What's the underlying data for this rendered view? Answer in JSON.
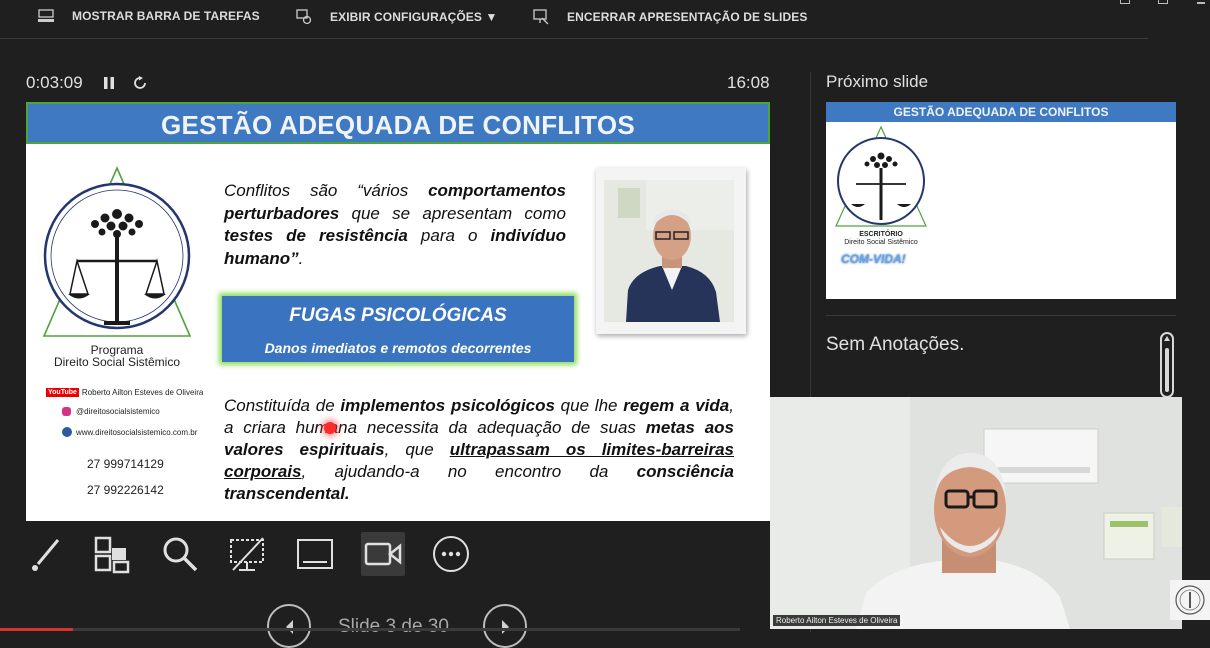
{
  "toolbar_top": {
    "show_taskbar": "MOSTRAR BARRA DE TAREFAS",
    "display_settings": "EXIBIR CONFIGURAÇÕES ▼",
    "end_show": "ENCERRAR APRESENTAÇÃO DE SLIDES"
  },
  "timer": {
    "elapsed": "0:03:09",
    "clock": "16:08"
  },
  "slide": {
    "title": "GESTÃO ADEQUADA DE CONFLITOS",
    "program_line1": "Programa",
    "program_line2": "Direito Social Sistêmico",
    "contacts": {
      "youtube_badge": "YouTube",
      "youtube": "Roberto Ailton Esteves de Oliveira",
      "instagram": "@direitosocialsistemico",
      "website": "www.direitosocialsistemico.com.br",
      "phone1": "27 999714129",
      "phone2": "27 992226142"
    },
    "para1": {
      "p1": "Conflitos são “vários ",
      "b1": "comportamentos perturbadores",
      "p2": " que se apresentam como ",
      "b2": "testes de resistência",
      "p3": " para o ",
      "b3": "indivíduo humano”",
      "p4": "."
    },
    "fugas": {
      "title": "FUGAS PSICOLÓGICAS",
      "subtitle": "Danos imediatos e remotos decorrentes"
    },
    "para2": {
      "p1": "Constituída de ",
      "b1": "implementos psicológicos",
      "p2": " que lhe ",
      "b2": "regem a vida",
      "p3": ", a cria",
      "p4": "ra humana necessita da adequação de suas ",
      "b3": "metas aos valores espirituais",
      "p5": ", que ",
      "u1": "ultrapassam os limites-barreiras corporais",
      "p6": ", ajudando-a no encontro da ",
      "b4": "consciência transcendental."
    }
  },
  "side": {
    "next_label": "Próximo slide",
    "next_title": "GESTÃO ADEQUADA DE CONFLITOS",
    "escritorio": "ESCRITÓRIO",
    "escritorio_sub": "Direito Social Sistêmico",
    "comvida": "COM-VIDA!",
    "notes": "Sem Anotações."
  },
  "nav": {
    "slide_counter": "Slide 3 de 30"
  },
  "camera": {
    "name": "Roberto Ailton Esteves de Oliveira"
  },
  "colors": {
    "banner": "#3f79c2",
    "banner_border": "#4fa33b",
    "fugas_glow": "#8ddc5c",
    "laser": "#ff2b2b",
    "progress": "#d6332b"
  }
}
